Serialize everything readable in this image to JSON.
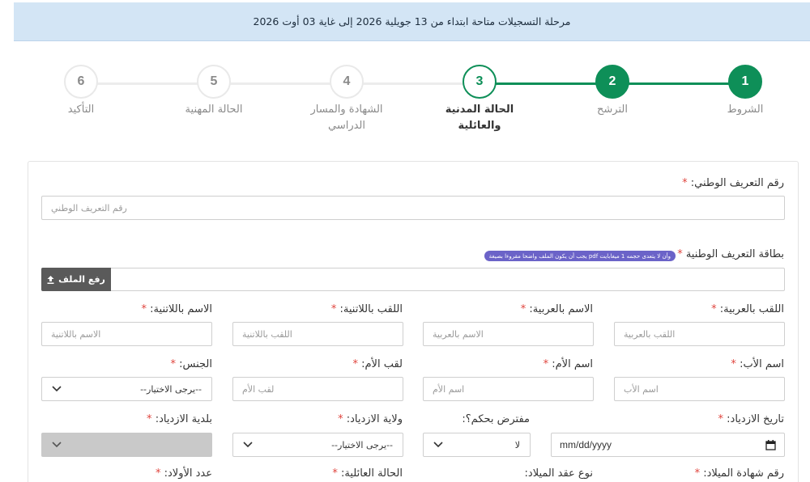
{
  "banner": {
    "text": "مرحلة التسجيلات متاحة ابتداء من 13 جويلية 2026 إلى غاية 03 أوت 2026"
  },
  "steps": [
    {
      "number": "1",
      "label": "الشروط",
      "state": "done"
    },
    {
      "number": "2",
      "label": "الترشح",
      "state": "done"
    },
    {
      "number": "3",
      "label": "الحالة المدنية والعائلية",
      "state": "current"
    },
    {
      "number": "4",
      "label_line1": "الشهادة والمسار",
      "label_line2": "الدراسي",
      "state": "pending"
    },
    {
      "number": "5",
      "label": "الحالة المهنية",
      "state": "pending"
    },
    {
      "number": "6",
      "label": "التأكيد",
      "state": "pending"
    }
  ],
  "colors": {
    "accent": "#0e8f58",
    "required": "#e0453e",
    "banner_bg": "#d3e5f5",
    "badge": "#6b63c8",
    "upload_btn": "#5a5a5a"
  },
  "required_mark": "*",
  "form": {
    "national_id": {
      "label": "رقم التعريف الوطني:",
      "placeholder": "رقم التعريف الوطني"
    },
    "id_card": {
      "label": "بطاقة التعريف الوطنية",
      "note": "يجب أن يكون الملف واضحا مقروءا بصيغة pdf وأن لا يتعدى حجمه 1 ميغابايت",
      "upload_label": "رفع الملف",
      "upload_icon": "upload-icon"
    },
    "last_name_ar": {
      "label": "اللقب بالعربية:",
      "placeholder": "اللقب بالعربية"
    },
    "first_name_ar": {
      "label": "الاسم بالعربية:",
      "placeholder": "الاسم بالعربية"
    },
    "last_name_lat": {
      "label": "اللقب باللاتنية:",
      "placeholder": "اللقب باللاتنية"
    },
    "first_name_lat": {
      "label": "الاسم باللاتنية:",
      "placeholder": "الاسم باللاتنية"
    },
    "father_name": {
      "label": "اسم الأب:",
      "placeholder": "اسم الأب"
    },
    "mother_name": {
      "label": "اسم الأم:",
      "placeholder": "اسم الأم"
    },
    "mother_last_name": {
      "label": "لقب الأم:",
      "placeholder": "لقب الأم"
    },
    "gender": {
      "label": "الجنس:",
      "value": "--يرجى الاختيار--"
    },
    "birth_date": {
      "label": "تاريخ الازدياد:",
      "value": "mm/dd/yyyy"
    },
    "presumed": {
      "label": "مفترض بحكم؟:",
      "value": "لا"
    },
    "birth_wilaya": {
      "label": "ولاية الازدياد:",
      "value": "--يرجى الاختيار--"
    },
    "birth_commune": {
      "label": "بلدية الازدياد:",
      "value": ""
    },
    "birth_cert_no": {
      "label": "رقم شهادة الميلاد:"
    },
    "birth_cert_type": {
      "label": "نوع عقد الميلاد:"
    },
    "family_status": {
      "label": "الحالة العائلية:"
    },
    "children_count": {
      "label": "عدد الأولاد:"
    }
  }
}
